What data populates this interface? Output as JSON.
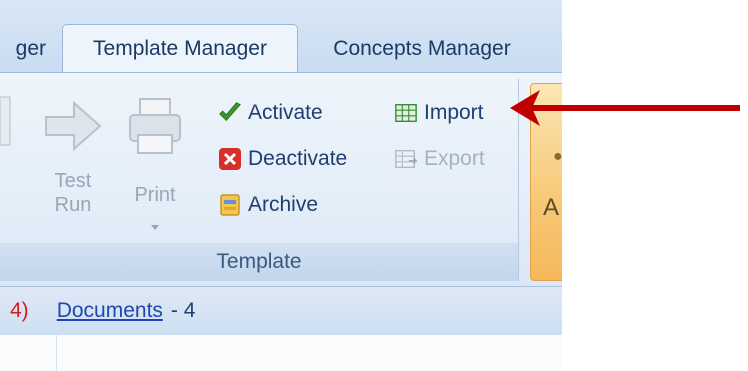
{
  "tabs": [
    {
      "label": "ger",
      "active": false
    },
    {
      "label": "Template Manager",
      "active": true
    },
    {
      "label": "Concepts Manager",
      "active": false
    }
  ],
  "ribbon": {
    "group_label": "Template",
    "test_run": {
      "line1": "Test",
      "line2": "Run",
      "icon": "arrow-right-icon"
    },
    "print": {
      "label": "Print",
      "icon": "printer-icon"
    },
    "activate": {
      "label": "Activate",
      "icon": "checkmark-icon"
    },
    "deactivate": {
      "label": "Deactivate",
      "icon": "red-x-icon"
    },
    "archive": {
      "label": "Archive",
      "icon": "archive-box-icon"
    },
    "import": {
      "label": "Import",
      "icon": "table-import-icon"
    },
    "export": {
      "label": "Export",
      "icon": "table-export-icon",
      "disabled": true
    },
    "next_group_letter": "A"
  },
  "crumbs": {
    "count_fragment": "4)",
    "link": "Documents",
    "count": "- 4"
  },
  "colors": {
    "arrow": "#c00000",
    "tab_text": "#1b3a63",
    "link": "#1f47b3"
  }
}
